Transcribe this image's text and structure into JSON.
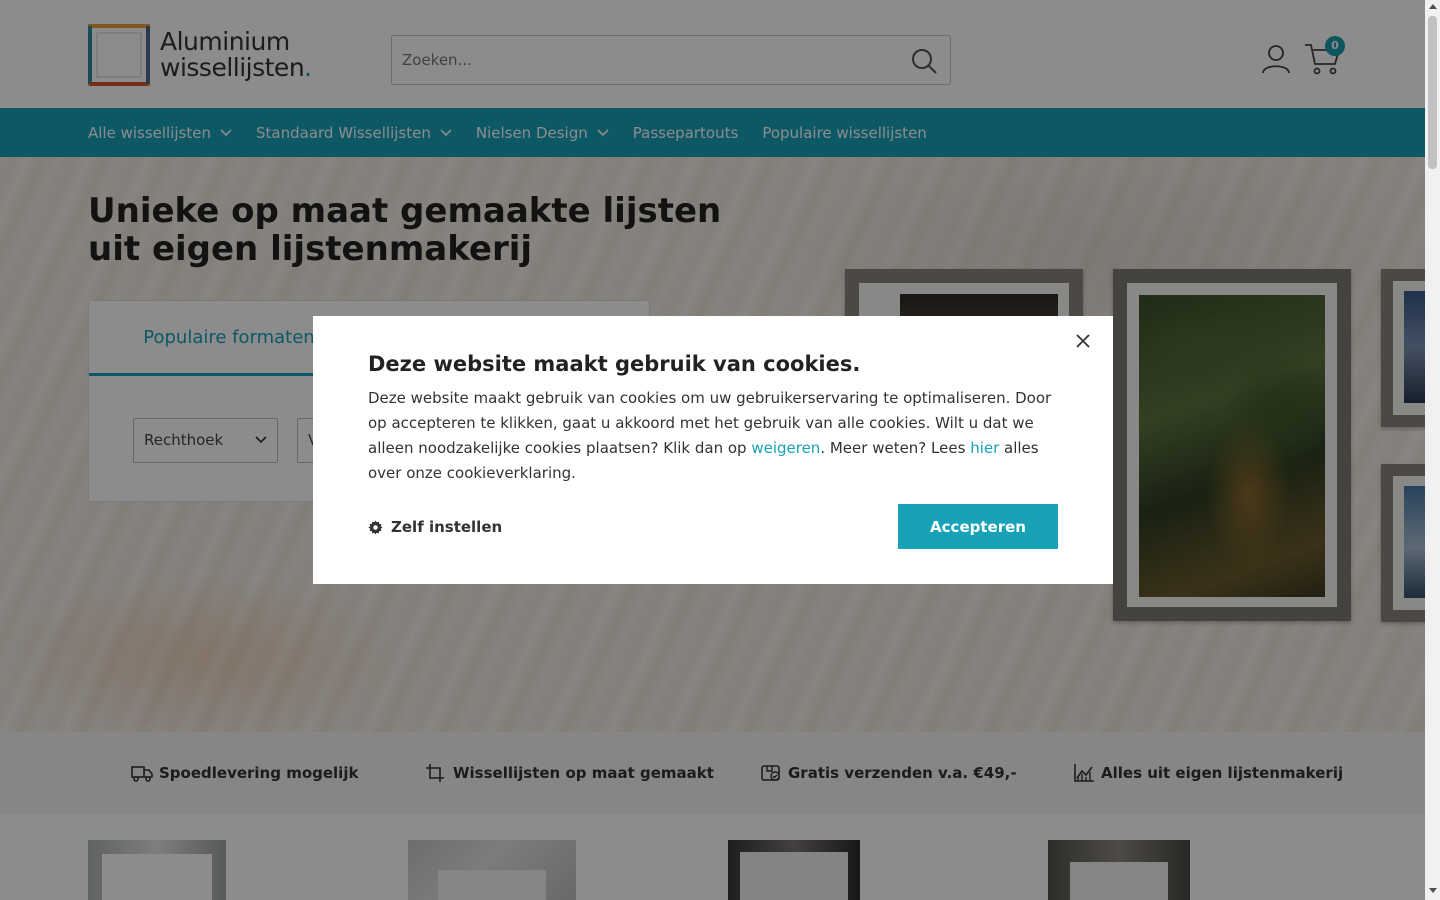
{
  "header": {
    "logo_line1": "Aluminium",
    "logo_line2": "wissellijsten",
    "logo_dot": ".",
    "search_placeholder": "Zoeken...",
    "cart_count": "0"
  },
  "nav": {
    "items": [
      {
        "label": "Alle wissellijsten",
        "dropdown": true
      },
      {
        "label": "Standaard Wissellijsten",
        "dropdown": true
      },
      {
        "label": "Nielsen Design",
        "dropdown": true
      },
      {
        "label": "Passepartouts",
        "dropdown": false
      },
      {
        "label": "Populaire wissellijsten",
        "dropdown": false
      }
    ]
  },
  "hero": {
    "title": "Unieke op maat gemaakte lijsten uit eigen lijstenmakerij",
    "filter_tab": "Populaire formaten",
    "shape_select": "Rechthoek",
    "second_select_visible": "V"
  },
  "usps": [
    {
      "icon": "truck-icon",
      "label": "Spoedlevering mogelijk"
    },
    {
      "icon": "crop-icon",
      "label": "Wissellijsten op maat gemaakt"
    },
    {
      "icon": "package-check-icon",
      "label": "Gratis verzenden v.a. €49,-"
    },
    {
      "icon": "chart-icon",
      "label": "Alles uit eigen lijstenmakerij"
    }
  ],
  "cookie_modal": {
    "title": "Deze website maakt gebruik van cookies.",
    "body_part1": "Deze website maakt gebruik van cookies om uw gebruikerservaring te optimaliseren. Door op accepteren te klikken, gaat u akkoord met het gebruik van alle cookies. Wilt u dat we alleen noodzakelijke cookies plaatsen? Klik dan op ",
    "link_refuse": "weigeren",
    "body_part2": ". Meer weten? Lees ",
    "link_here": "hier",
    "body_part3": " alles over onze cookieverklaring.",
    "settings_label": "Zelf instellen",
    "accept_label": "Accepteren"
  },
  "colors": {
    "accent": "#17a2b8",
    "overlay": "rgba(0,0,0,0.45)"
  }
}
